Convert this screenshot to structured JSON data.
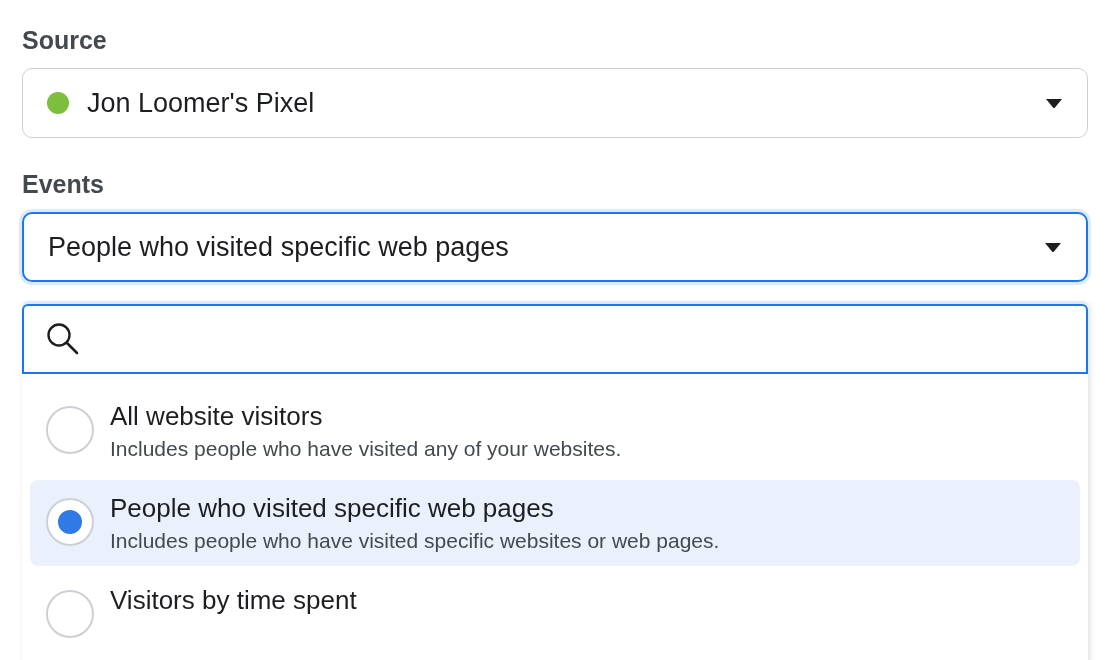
{
  "source": {
    "label": "Source",
    "value": "Jon Loomer's Pixel",
    "color": "#7cbf3c"
  },
  "events": {
    "label": "Events",
    "value": "People who visited specific web pages",
    "focused": true
  },
  "search": {
    "focused": true
  },
  "options": [
    {
      "title": "All website visitors",
      "description": "Includes people who have visited any of your websites.",
      "selected": false
    },
    {
      "title": "People who visited specific web pages",
      "description": "Includes people who have visited specific websites or web pages.",
      "selected": true
    },
    {
      "title": "Visitors by time spent",
      "selected": false
    }
  ]
}
